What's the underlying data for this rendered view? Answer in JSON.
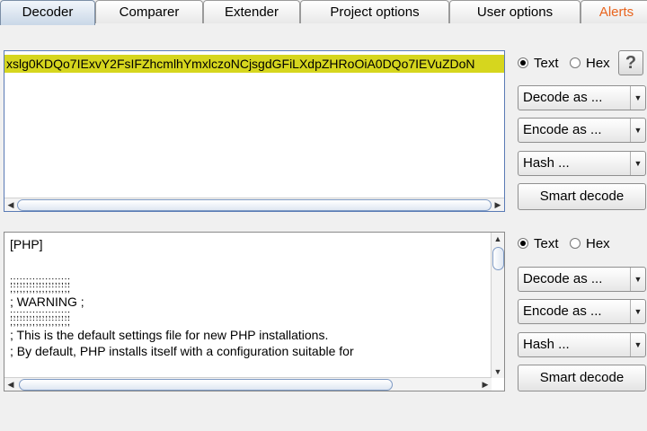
{
  "tabs": [
    {
      "label": "Decoder",
      "active": true
    },
    {
      "label": "Comparer"
    },
    {
      "label": "Extender"
    },
    {
      "label": "Project options"
    },
    {
      "label": "User options"
    },
    {
      "label": "Alerts",
      "alert": true
    }
  ],
  "panel1": {
    "text": "xslg0KDQo7IExvY2FsIFZhcmlhYmxlczoNCjsgdGFiLXdpZHRoOiA0DQo7IEVuZDoN",
    "radio_text": "Text",
    "radio_hex": "Hex",
    "selected_mode": "Text",
    "help": "?",
    "decode_as": "Decode as ...",
    "encode_as": "Encode as ...",
    "hash": "Hash ...",
    "smart_decode": "Smart decode"
  },
  "panel2": {
    "lines": [
      "[PHP]",
      "",
      ";;;;;;;;;;;;;;;;;;;",
      ";;;;;;;;;;;;;;;;;;;",
      "; WARNING ;",
      ";;;;;;;;;;;;;;;;;;;",
      ";;;;;;;;;;;;;;;;;;;",
      "; This is the default settings file for new PHP installations.",
      "; By default, PHP installs itself with a configuration suitable for"
    ],
    "radio_text": "Text",
    "radio_hex": "Hex",
    "selected_mode": "Text",
    "decode_as": "Decode as ...",
    "encode_as": "Encode as ...",
    "hash": "Hash ...",
    "smart_decode": "Smart decode"
  },
  "icons": {
    "left_arrow": "◀",
    "right_arrow": "▶",
    "up_arrow": "▲",
    "down_arrow": "▼"
  },
  "colors": {
    "highlight": "#d6d61e",
    "alert_tab": "#e8641e"
  }
}
